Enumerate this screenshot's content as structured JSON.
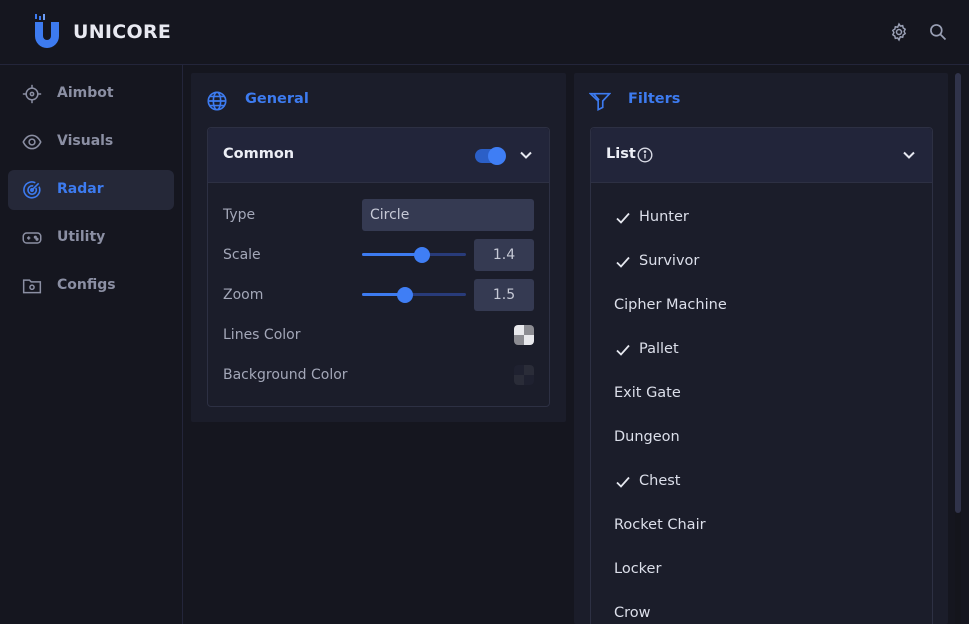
{
  "app": {
    "name": "UNICORE"
  },
  "header": {
    "icons": [
      "settings-icon",
      "search-icon"
    ]
  },
  "sidebar": {
    "items": [
      {
        "label": "Aimbot",
        "icon": "crosshair-icon",
        "active": false
      },
      {
        "label": "Visuals",
        "icon": "eye-icon",
        "active": false
      },
      {
        "label": "Radar",
        "icon": "radar-icon",
        "active": true
      },
      {
        "label": "Utility",
        "icon": "gamepad-icon",
        "active": false
      },
      {
        "label": "Configs",
        "icon": "folder-gear-icon",
        "active": false
      }
    ]
  },
  "general": {
    "title": "General",
    "icon": "globe-icon",
    "card": {
      "title": "Common",
      "enabled": true,
      "type_label": "Type",
      "type_value": "Circle",
      "scale_label": "Scale",
      "scale_value": "1.4",
      "scale_fraction": 0.58,
      "zoom_label": "Zoom",
      "zoom_value": "1.5",
      "zoom_fraction": 0.41,
      "lines_color_label": "Lines Color",
      "background_color_label": "Background Color"
    }
  },
  "filters": {
    "title": "Filters",
    "icon": "filter-icon",
    "card": {
      "title": "List",
      "info_icon": "info-icon",
      "items": [
        {
          "label": "Hunter",
          "checked": true
        },
        {
          "label": "Survivor",
          "checked": true
        },
        {
          "label": "Cipher Machine",
          "checked": false
        },
        {
          "label": "Pallet",
          "checked": true
        },
        {
          "label": "Exit Gate",
          "checked": false
        },
        {
          "label": "Dungeon",
          "checked": false
        },
        {
          "label": "Chest",
          "checked": true
        },
        {
          "label": "Rocket Chair",
          "checked": false
        },
        {
          "label": "Locker",
          "checked": false
        },
        {
          "label": "Crow",
          "checked": false
        }
      ]
    }
  },
  "colors": {
    "accent": "#3d7bf0",
    "background": "#15161f",
    "panel": "#1b1d2a"
  }
}
